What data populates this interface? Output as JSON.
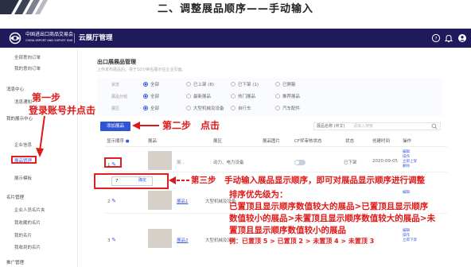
{
  "slide": {
    "title": "二、调整展品顺序——手动输入"
  },
  "topbar": {
    "logo_line1": "中国进出口商品交易会",
    "logo_line2": "CHINA IMPORT AND EXPORT FAIR",
    "app_title": "云展厅管理",
    "icons": [
      "help-icon",
      "bell-icon",
      "user-icon"
    ]
  },
  "sidebar": {
    "items": [
      {
        "label": "全部意向订单",
        "type": "item"
      },
      {
        "label": "我的意向订单",
        "type": "item"
      },
      {
        "label": "消息中心",
        "type": "group"
      },
      {
        "label": "消息通知",
        "type": "item"
      },
      {
        "label": "我的展示中心",
        "type": "group"
      },
      {
        "label": "企业信息",
        "type": "item"
      },
      {
        "label": "展品管理",
        "type": "item",
        "active": true
      },
      {
        "label": "展示模板",
        "type": "item"
      },
      {
        "label": "名片管理",
        "type": "group"
      },
      {
        "label": "企业人员名片夹",
        "type": "item"
      },
      {
        "label": "我收藏的名片",
        "type": "item"
      },
      {
        "label": "我的名片",
        "type": "item"
      },
      {
        "label": "我收到的名片",
        "type": "item"
      },
      {
        "label": "推广管理",
        "type": "group"
      }
    ]
  },
  "main": {
    "title": "出口展展品管理",
    "subtitle": "上传发布展品后，将于10分钟后展示在企业页面。",
    "filters": [
      {
        "label": "状态",
        "options": [
          {
            "text": "全部",
            "selected": true
          },
          {
            "text": "已上架 (8)"
          },
          {
            "text": "已下架 (1)"
          },
          {
            "text": "已屏蔽"
          }
        ]
      },
      {
        "label": "展品分组",
        "options": [
          {
            "text": "全部",
            "selected": true
          },
          {
            "text": "最新展品"
          },
          {
            "text": "热门展品"
          },
          {
            "text": "推荐展品"
          }
        ]
      },
      {
        "label": "展区",
        "options": [
          {
            "text": "全部",
            "selected": true
          },
          {
            "text": "大型机械及设备"
          },
          {
            "text": "自行车"
          },
          {
            "text": "汽车配件"
          }
        ]
      }
    ],
    "add_button": "添加展品",
    "search": {
      "select": "展品名称 (中文)",
      "placeholder": "请输入搜索"
    },
    "table": {
      "headers": [
        "显示顺序",
        "展品",
        "",
        "展区",
        "展品图片",
        "CF奖审核状态",
        "状态",
        "创建时间",
        "操作"
      ],
      "rows": [
        {
          "order": "1",
          "name": "展...",
          "zone": "动力、电力设备",
          "status": "已下架",
          "date": "2020-09-05",
          "ops": [
            "编辑",
            "操作",
            "立即上架",
            "删除"
          ]
        },
        {
          "order": "2",
          "name": "展品1",
          "zone": "大型机械及设备",
          "status": "已上架",
          "date": "2020-09-05",
          "ops": [
            "编辑",
            "操作",
            "立即下架",
            "删除"
          ]
        },
        {
          "order": "3",
          "name": "展品2",
          "zone": "大型机械及设备",
          "status": "已上架",
          "date": "2020-09-05",
          "ops": [
            "编辑",
            "操作",
            "立即下架",
            "删除"
          ]
        }
      ],
      "order_input_value": "7",
      "order_confirm": "确定"
    }
  },
  "annotations": {
    "step1_line1": "第一步",
    "step1_line2": "登录账号并点击",
    "step2": "第二步　点击",
    "step3_intro": "第三步　手动输入展品显示顺序，即可对展品显示顺序进行调整",
    "step3_rule_title": "排序优先级为：",
    "step3_rule_1": "已置顶且显示顺序数值较大的展品>已置顶且显示顺序",
    "step3_rule_2": "数值较小的展品>未置顶且显示顺序数值较大的展品>未",
    "step3_rule_3": "置顶且显示顺序数值较小的展品",
    "step3_example": "例：已置顶 5 > 已置顶 2 > 未置顶 4 > 未置顶 3"
  },
  "colors": {
    "topbar": "#1f1a5c",
    "accent": "#2f54d6",
    "annotation": "#e01818"
  }
}
